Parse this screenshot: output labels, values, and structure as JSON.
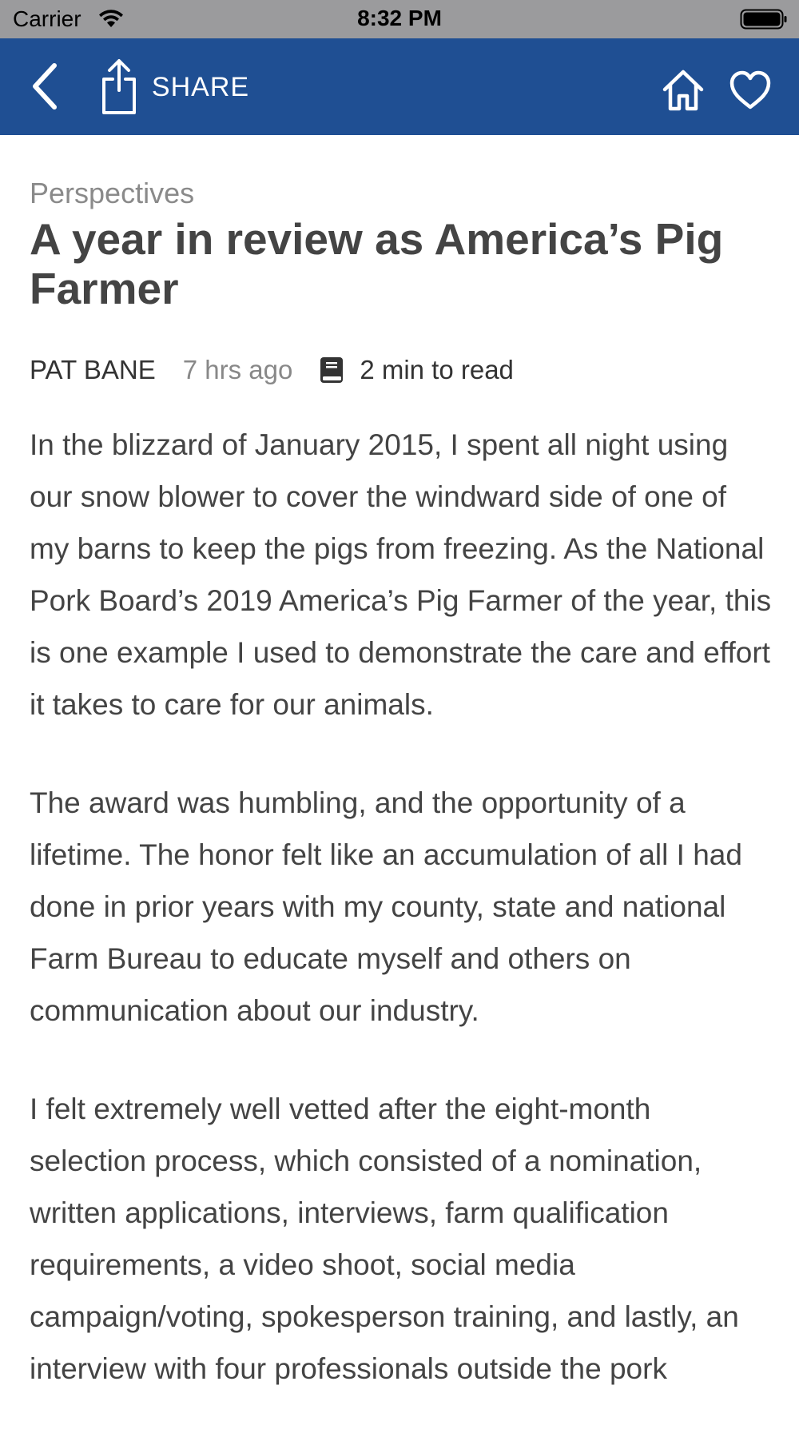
{
  "status_bar": {
    "carrier": "Carrier",
    "time": "8:32 PM"
  },
  "nav": {
    "back_icon": "chevron-left-icon",
    "share_label": "SHARE",
    "share_icon": "share-icon",
    "home_icon": "home-icon",
    "favorite_icon": "heart-icon",
    "background_color": "#1f4f93"
  },
  "article": {
    "category": "Perspectives",
    "title": "A year in review as America’s Pig Farmer",
    "author": "PAT BANE",
    "time_ago": "7 hrs ago",
    "read_time": "2 min to read",
    "paragraphs": [
      "In the blizzard of January 2015, I spent all night using our snow blower to cover the windward side of one of my barns to keep the pigs from freezing. As the National Pork Board’s 2019 America’s Pig Farmer of the year, this is one example I used to demonstrate the care and effort it takes to care for our animals.",
      "The award was humbling, and the opportunity of a lifetime. The honor felt like an accumulation of all I had done in prior years with my county, state and national Farm Bureau to educate myself and others on communication about our industry.",
      "I felt extremely well vetted after the eight-month selection process, which consisted of a nomination, written applications, interviews, farm qualification requirements, a video shoot, social media campaign/voting, spokesperson training, and lastly, an interview with four professionals outside the pork"
    ]
  }
}
